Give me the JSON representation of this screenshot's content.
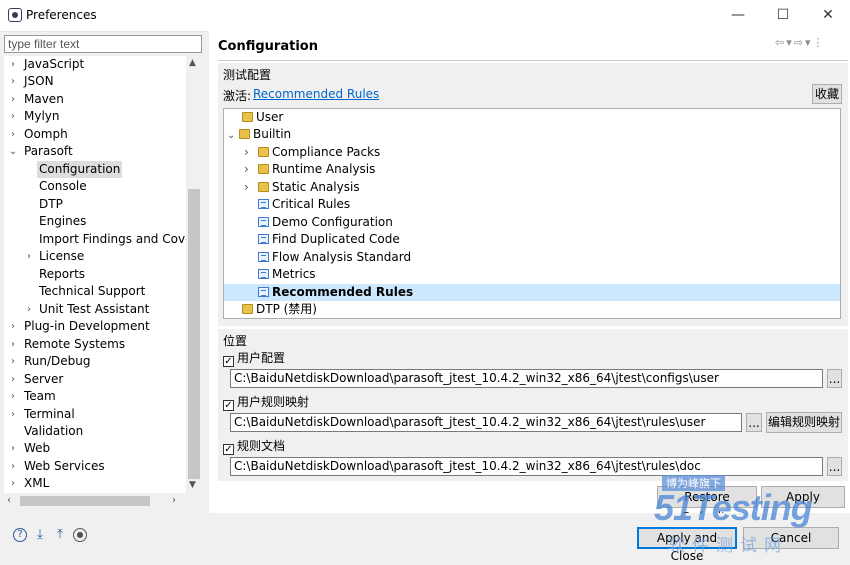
{
  "window": {
    "title": "Preferences",
    "minimize": "—",
    "maximize": "☐",
    "close": "✕"
  },
  "filter": {
    "placeholder": "type filter text"
  },
  "tree": {
    "javascript": "JavaScript",
    "json": "JSON",
    "maven": "Maven",
    "mylyn": "Mylyn",
    "oomph": "Oomph",
    "parasoft": "Parasoft",
    "configuration": "Configuration",
    "console": "Console",
    "dtp": "DTP",
    "engines": "Engines",
    "import_findings": "Import Findings and Cover",
    "license": "License",
    "reports": "Reports",
    "technical_support": "Technical Support",
    "unit_test_assistant": "Unit Test Assistant",
    "plugin_dev": "Plug-in Development",
    "remote_systems": "Remote Systems",
    "run_debug": "Run/Debug",
    "server": "Server",
    "team": "Team",
    "terminal": "Terminal",
    "validation": "Validation",
    "web": "Web",
    "web_services": "Web Services",
    "xml": "XML"
  },
  "page": {
    "title": "Configuration"
  },
  "test_config": {
    "group_label": "测试配置",
    "active_label": "激活:",
    "active_link": "Recommended Rules",
    "favorite_button": "收藏",
    "items": {
      "user": "User",
      "builtin": "Builtin",
      "compliance": "Compliance Packs",
      "runtime": "Runtime Analysis",
      "static": "Static Analysis",
      "critical": "Critical Rules",
      "demo": "Demo Configuration",
      "duplicated": "Find Duplicated Code",
      "flow": "Flow Analysis Standard",
      "metrics": "Metrics",
      "recommended": "Recommended Rules",
      "dtp": "DTP (禁用)"
    }
  },
  "location": {
    "group_label": "位置",
    "user_config": {
      "label": "用户配置",
      "path": "C:\\BaiduNetdiskDownload\\parasoft_jtest_10.4.2_win32_x86_64\\jtest\\configs\\user",
      "browse": "..."
    },
    "user_rule_map": {
      "label": "用户规则映射",
      "path": "C:\\BaiduNetdiskDownload\\parasoft_jtest_10.4.2_win32_x86_64\\jtest\\rules\\user",
      "browse": "...",
      "edit_button": "编辑规则映射"
    },
    "rule_docs": {
      "label": "规则文档",
      "path": "C:\\BaiduNetdiskDownload\\parasoft_jtest_10.4.2_win32_x86_64\\jtest\\rules\\doc",
      "browse": "..."
    }
  },
  "buttons": {
    "restore_defaults": "Restore Defaults",
    "apply": "Apply",
    "apply_close": "Apply and Close",
    "cancel": "Cancel"
  },
  "watermark": {
    "top": "博为峰旗下",
    "brand": "51Testing",
    "bottom": "软件测试网"
  }
}
